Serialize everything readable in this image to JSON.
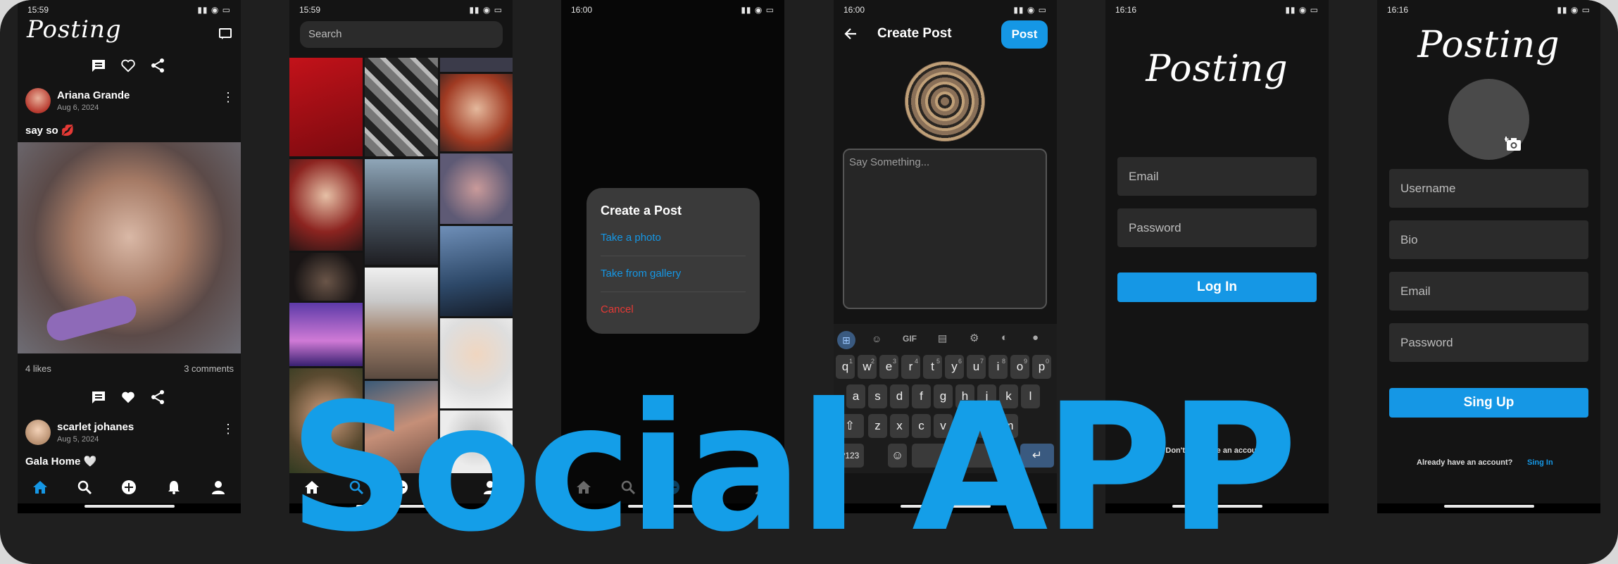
{
  "banner": {
    "title": "Social APP"
  },
  "phone1": {
    "time": "15:59",
    "logo": "Posting",
    "post1": {
      "user": "Ariana Grande",
      "date": "Aug 6, 2024",
      "caption": "say so 💋",
      "likes": "4 likes",
      "comments": "3 comments"
    },
    "post2": {
      "user": "scarlet johanes",
      "date": "Aug 5, 2024",
      "caption": "Gala Home 🤍"
    }
  },
  "phone2": {
    "time": "15:59",
    "search_placeholder": "Search"
  },
  "phone3": {
    "time": "16:00",
    "dialog": {
      "title": "Create a Post",
      "option1": "Take a photo",
      "option2": "Take from gallery",
      "cancel": "Cancel"
    }
  },
  "phone4": {
    "time": "16:00",
    "title": "Create Post",
    "post_button": "Post",
    "placeholder": "Say Something...",
    "keyboard": {
      "row1": [
        "q",
        "w",
        "e",
        "r",
        "t",
        "y",
        "u",
        "i",
        "o",
        "p"
      ],
      "row1_nums": [
        "1",
        "2",
        "3",
        "4",
        "5",
        "6",
        "7",
        "8",
        "9",
        "0"
      ],
      "row2": [
        "a",
        "s",
        "d",
        "f",
        "g",
        "h",
        "j",
        "k",
        "l"
      ],
      "row3": [
        "z",
        "x",
        "c",
        "v",
        "b",
        "n",
        "m"
      ],
      "symbols_key": "?123",
      "gif": "GIF"
    }
  },
  "phone5": {
    "time": "16:16",
    "logo": "Posting",
    "email": "Email",
    "password": "Password",
    "login": "Log In",
    "no_account": "Don't you have an account?"
  },
  "phone6": {
    "time": "16:16",
    "logo": "Posting",
    "username": "Username",
    "bio": "Bio",
    "email": "Email",
    "password": "Password",
    "signup": "Sing Up",
    "already": "Already have an account?",
    "signin": "Sing In"
  },
  "colors": {
    "accent": "#1597e5",
    "cancel": "#e53935",
    "background": "#141414"
  }
}
